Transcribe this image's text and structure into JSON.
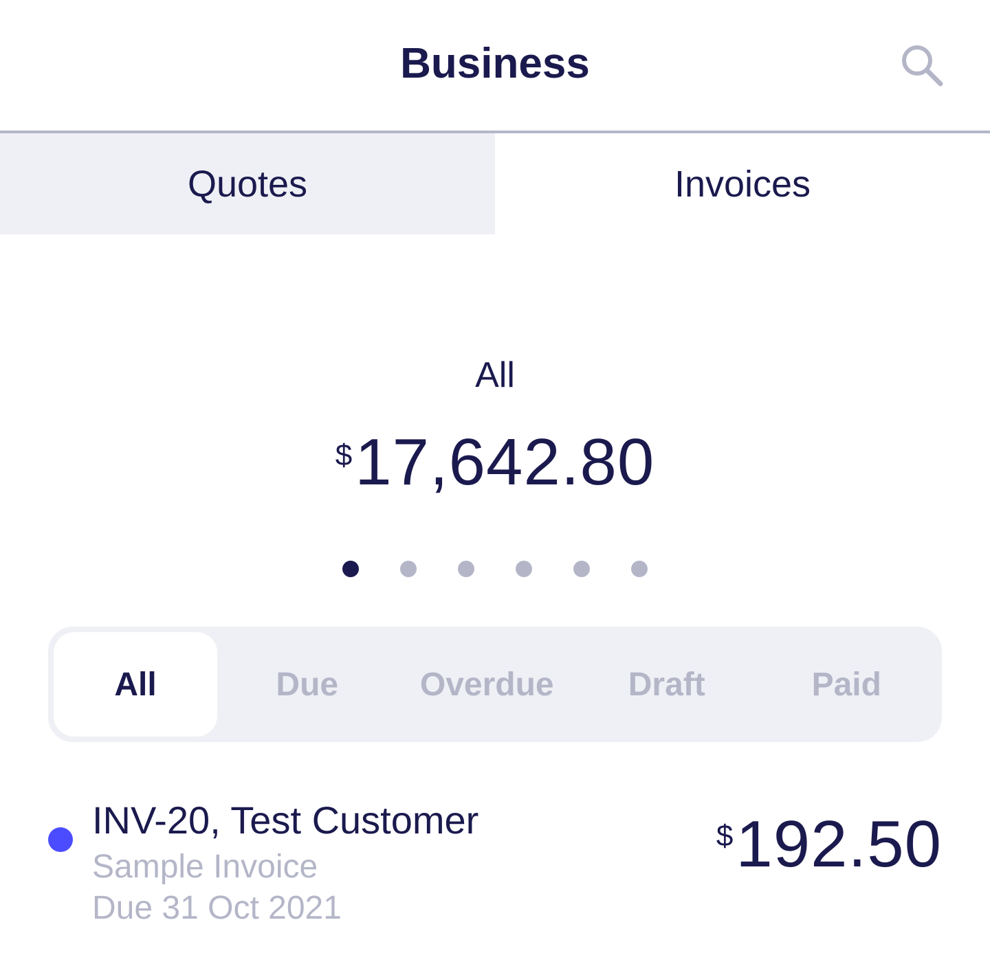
{
  "header": {
    "title": "Business",
    "search_icon": "search-icon"
  },
  "tabs": [
    {
      "label": "Quotes",
      "active": false
    },
    {
      "label": "Invoices",
      "active": true
    }
  ],
  "summary": {
    "label": "All",
    "currency": "$",
    "amount": "17,642.80"
  },
  "pager": {
    "count": 6,
    "active_index": 0
  },
  "filters": [
    {
      "label": "All",
      "selected": true
    },
    {
      "label": "Due",
      "selected": false
    },
    {
      "label": "Overdue",
      "selected": false
    },
    {
      "label": "Draft",
      "selected": false
    },
    {
      "label": "Paid",
      "selected": false
    }
  ],
  "invoices": [
    {
      "title": "INV-20, Test Customer",
      "description": "Sample Invoice",
      "due": "Due 31 Oct 2021",
      "currency": "$",
      "amount": "192.50",
      "status_color": "#4b4cff"
    }
  ],
  "colors": {
    "primary_text": "#1b1a4e",
    "muted_text": "#b4b6c8",
    "panel_bg": "#eff0f5",
    "accent": "#4b4cff"
  }
}
